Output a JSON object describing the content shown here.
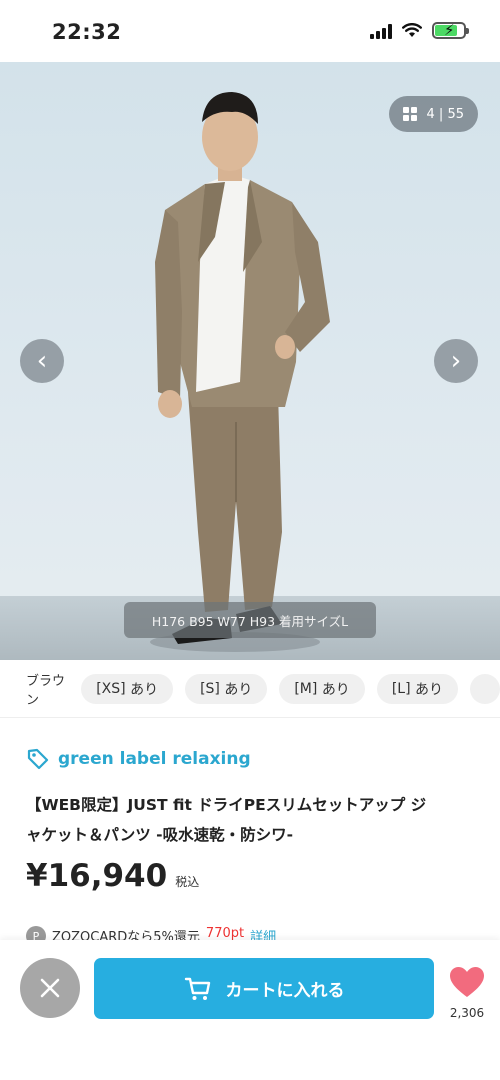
{
  "status_bar": {
    "time": "22:32"
  },
  "gallery": {
    "counter_current": "4",
    "counter_total": "55",
    "caption": "H176 B95 W77 H93 着用サイズL"
  },
  "variants": {
    "color_label": "ブラウン",
    "sizes": [
      {
        "size": "[XS]",
        "stock": "あり"
      },
      {
        "size": "[S]",
        "stock": "あり"
      },
      {
        "size": "[M]",
        "stock": "あり"
      },
      {
        "size": "[L]",
        "stock": "あり"
      }
    ]
  },
  "product": {
    "brand": "green label relaxing",
    "title_line1": "【WEB限定】JUST fit ドライPEスリムセットアップ ジ",
    "title_line2": "ャケット＆パンツ -吸水速乾・防シワ-",
    "price": "¥16,940",
    "tax_label": "税込"
  },
  "card_promo": {
    "icon_letter": "P",
    "text": "ZOZOCARDなら5%還元",
    "points": "770pt",
    "link": "詳細"
  },
  "actions": {
    "cart_label": "カートに入れる",
    "favorite_count": "2,306"
  },
  "colors": {
    "accent": "#27aee0",
    "brand": "#2ba7cf",
    "heart": "#f26b7e",
    "close_button": "#a7a7a7"
  }
}
